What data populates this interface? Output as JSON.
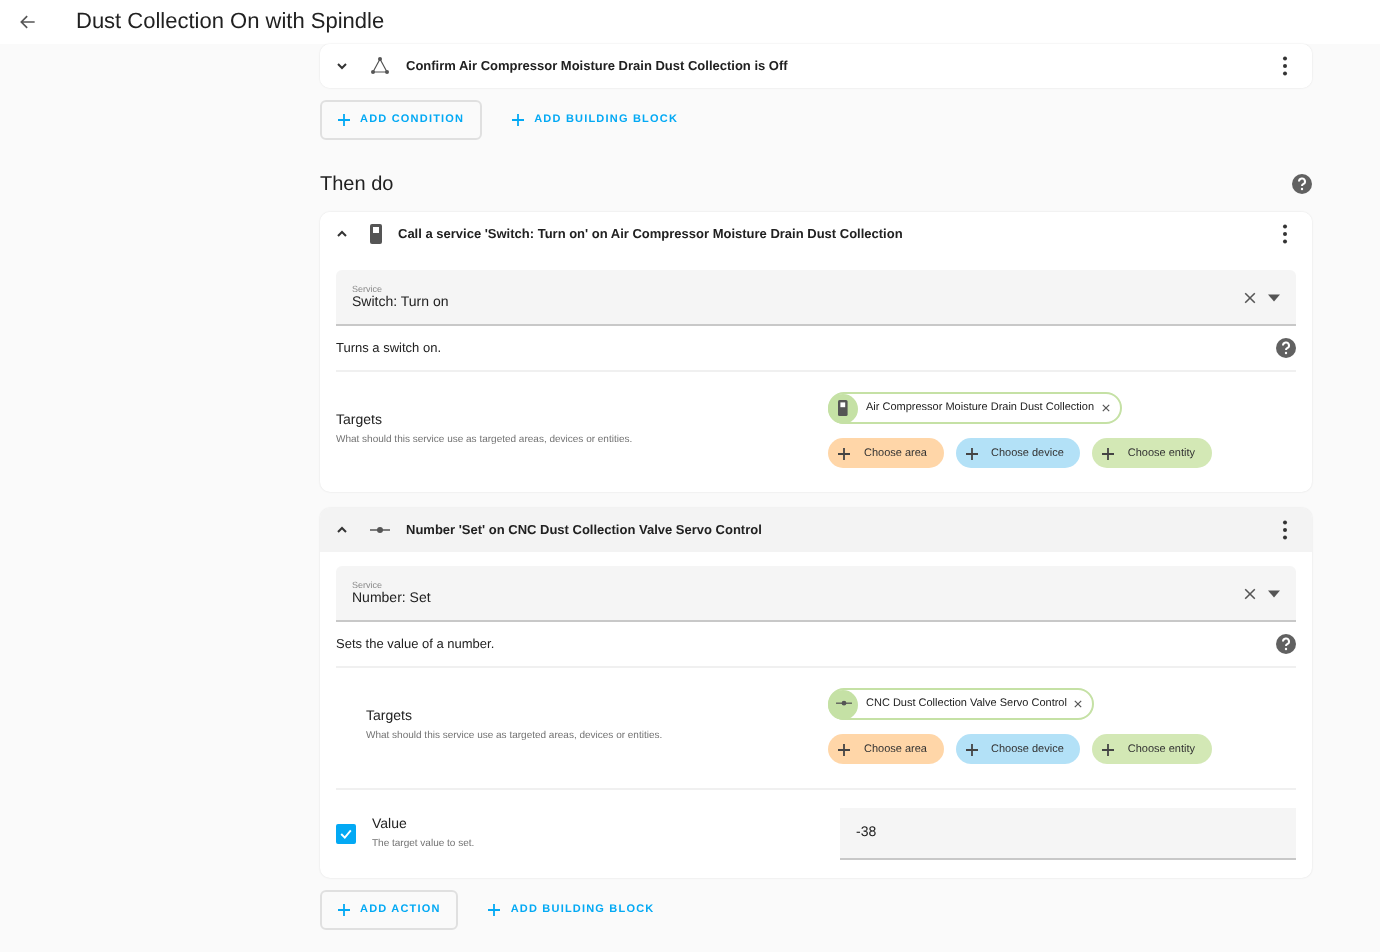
{
  "header": {
    "title": "Dust Collection On with Spindle"
  },
  "conditions": [
    {
      "title": "Confirm Air Compressor Moisture Drain Dust Collection is Off",
      "expanded": false
    }
  ],
  "condition_buttons": [
    {
      "label": "ADD CONDITION",
      "outlined": true
    },
    {
      "label": "ADD BUILDING BLOCK",
      "outlined": false
    }
  ],
  "actions_heading": "Then do",
  "actions": [
    {
      "title": "Call a service 'Switch: Turn on' on Air Compressor Moisture Drain Dust Collection",
      "kind": "switch",
      "expanded": true,
      "highlighted": false,
      "service_label": "Service",
      "service_value": "Switch: Turn on",
      "description": "Turns a switch on.",
      "targets": {
        "label": "Targets",
        "hint": "What should this service use as targeted areas, devices or entities.",
        "entity": "Air Compressor Moisture Drain Dust Collection",
        "choose": [
          {
            "label": "Choose area",
            "kind": "area"
          },
          {
            "label": "Choose device",
            "kind": "device"
          },
          {
            "label": "Choose entity",
            "kind": "entity"
          }
        ]
      }
    },
    {
      "title": "Number 'Set' on CNC Dust Collection Valve Servo Control",
      "kind": "number",
      "expanded": true,
      "highlighted": true,
      "service_label": "Service",
      "service_value": "Number: Set",
      "description": "Sets the value of a number.",
      "targets": {
        "label": "Targets",
        "hint": "What should this service use as targeted areas, devices or entities.",
        "entity": "CNC Dust Collection Valve Servo Control",
        "choose": [
          {
            "label": "Choose area",
            "kind": "area"
          },
          {
            "label": "Choose device",
            "kind": "device"
          },
          {
            "label": "Choose entity",
            "kind": "entity"
          }
        ]
      },
      "fields": [
        {
          "label": "Value",
          "hint": "The target value to set.",
          "checked": true,
          "value": "-38"
        }
      ]
    }
  ],
  "action_buttons": [
    {
      "label": "ADD ACTION",
      "outlined": true
    },
    {
      "label": "ADD BUILDING BLOCK",
      "outlined": false
    }
  ]
}
